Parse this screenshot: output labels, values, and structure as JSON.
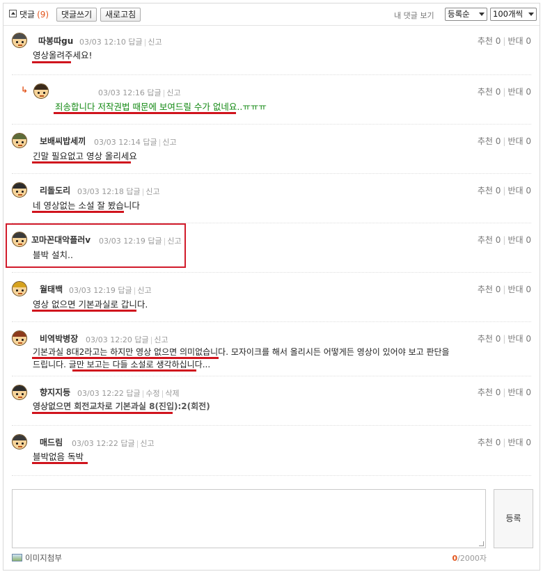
{
  "header": {
    "title": "댓글",
    "count": "(9)",
    "write_button": "댓글쓰기",
    "refresh_button": "새로고침",
    "my_comments_link": "내 댓글 보기",
    "sort_select": "등록순",
    "page_size_select": "100개씩"
  },
  "vote_labels": {
    "up": "추천",
    "down": "반대"
  },
  "comments": [
    {
      "nick": "따봉따gu",
      "date": "03/03 12:10",
      "actions": [
        "답글",
        "신고"
      ],
      "up": "0",
      "down": "0",
      "text": "영상올려주세요!"
    },
    {
      "nick": "",
      "date": "03/03 12:16",
      "actions": [
        "답글",
        "신고"
      ],
      "up": "0",
      "down": "0",
      "text": "죄송합니다 저작권법 때문에 보여드릴 수가 없네요..ㅠㅠㅠ"
    },
    {
      "nick": "보배씨밥세끼",
      "date": "03/03 12:14",
      "actions": [
        "답글",
        "신고"
      ],
      "up": "0",
      "down": "0",
      "text": "긴말 필요없고 영상 올리세요"
    },
    {
      "nick": "리돌도리",
      "date": "03/03 12:18",
      "actions": [
        "답글",
        "신고"
      ],
      "up": "0",
      "down": "0",
      "text": "네 영상없는 소설 잘 봤습니다"
    },
    {
      "nick": "꼬마꼰대악플러v",
      "date": "03/03 12:19",
      "actions": [
        "답글",
        "신고"
      ],
      "up": "0",
      "down": "0",
      "text": "블박 설치.."
    },
    {
      "nick": "월태백",
      "date": "03/03 12:19",
      "actions": [
        "답글",
        "신고"
      ],
      "up": "0",
      "down": "0",
      "text": "영상 없으면 기본과실로 갑니다."
    },
    {
      "nick": "비역박병장",
      "date": "03/03 12:20",
      "actions": [
        "답글",
        "신고"
      ],
      "up": "0",
      "down": "0",
      "text_line1": "기본과실 8대2라고는 하지만 영상 없으면 의미없습니다. 모자이크를 해서 올리시든 어떻게든 영상이 있어야 보고 판단을",
      "text_line2": "드립니다. 글만 보고는 다들 소설로 생각하십니다..."
    },
    {
      "nick": "향지지등",
      "date": "03/03 12:22",
      "actions": [
        "답글",
        "수정",
        "삭제"
      ],
      "up": "0",
      "down": "0",
      "text": "영상없으면 회전교차로 기본과실 8(진입):2(회전)"
    },
    {
      "nick": "매드림",
      "date": "03/03 12:22",
      "actions": [
        "답글",
        "신고"
      ],
      "up": "0",
      "down": "0",
      "text": "블박없음 독박"
    }
  ],
  "editor": {
    "submit_button": "등록",
    "image_attach": "이미지첨부",
    "char_count_current": "0",
    "char_count_max": "/2000자"
  },
  "colors": {
    "accent": "#e2541b",
    "reply_text": "#118811",
    "annotation_red": "#d0141d"
  }
}
